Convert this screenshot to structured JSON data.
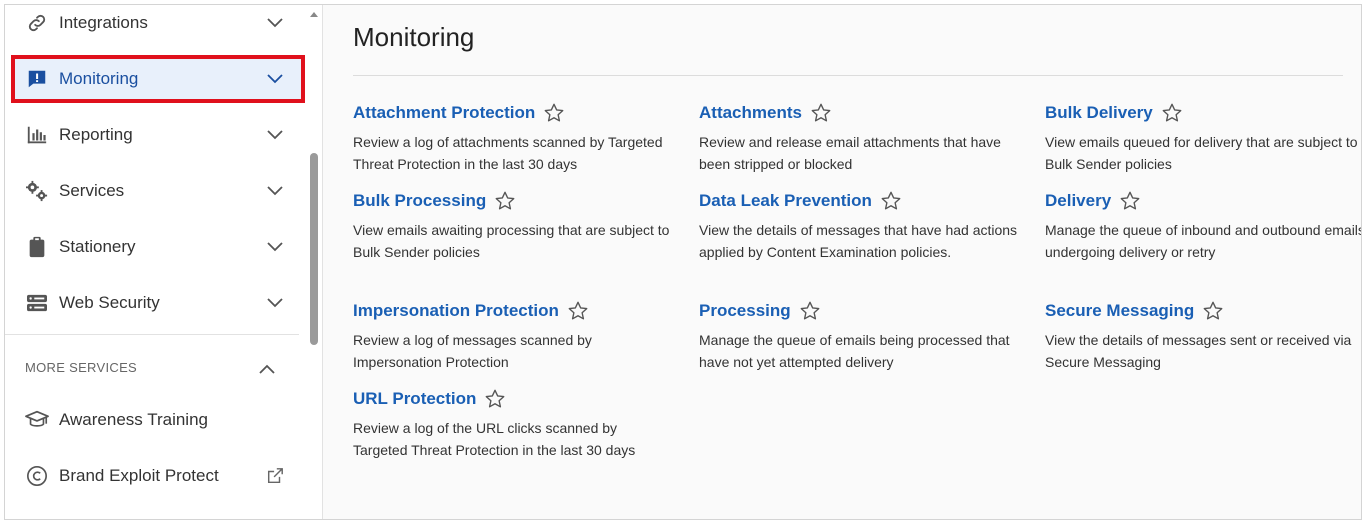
{
  "sidebar": {
    "items": [
      {
        "label": "Integrations",
        "icon": "link-icon"
      },
      {
        "label": "Monitoring",
        "icon": "alert-message-icon"
      },
      {
        "label": "Reporting",
        "icon": "bar-chart-icon"
      },
      {
        "label": "Services",
        "icon": "gears-icon"
      },
      {
        "label": "Stationery",
        "icon": "clipboard-icon"
      },
      {
        "label": "Web Security",
        "icon": "server-icon"
      }
    ],
    "more_header": "MORE SERVICES",
    "more_items": [
      {
        "label": "Awareness Training",
        "icon": "graduation-cap-icon"
      },
      {
        "label": "Brand Exploit Protect",
        "icon": "copyright-icon"
      }
    ]
  },
  "main": {
    "title": "Monitoring",
    "cards": [
      {
        "name": "Attachment Protection",
        "desc": "Review a log of attachments scanned by Targeted Threat Protection in the last 30 days"
      },
      {
        "name": "Attachments",
        "desc": "Review and release email attachments that have been stripped or blocked"
      },
      {
        "name": "Bulk Delivery",
        "desc": "View emails queued for delivery that are subject to Bulk Sender policies"
      },
      {
        "name": "Bulk Processing",
        "desc": "View emails awaiting processing that are subject to Bulk Sender policies"
      },
      {
        "name": "Data Leak Prevention",
        "desc": "View the details of messages that have had actions applied by Content Examination policies."
      },
      {
        "name": "Delivery",
        "desc": "Manage the queue of inbound and outbound emails undergoing delivery or retry"
      },
      {
        "name": "Impersonation Protection",
        "desc": "Review a log of messages scanned by Impersonation Protection"
      },
      {
        "name": "Processing",
        "desc": "Manage the queue of emails being processed that have not yet attempted delivery"
      },
      {
        "name": "Secure Messaging",
        "desc": "View the details of messages sent or received via Secure Messaging"
      },
      {
        "name": "URL Protection",
        "desc": "Review a log of the URL clicks scanned by Targeted Threat Protection in the last 30 days"
      }
    ]
  },
  "colors": {
    "accent": "#1a5fb4",
    "highlight_border": "#e0101c",
    "active_bg": "#e8f0fb"
  }
}
